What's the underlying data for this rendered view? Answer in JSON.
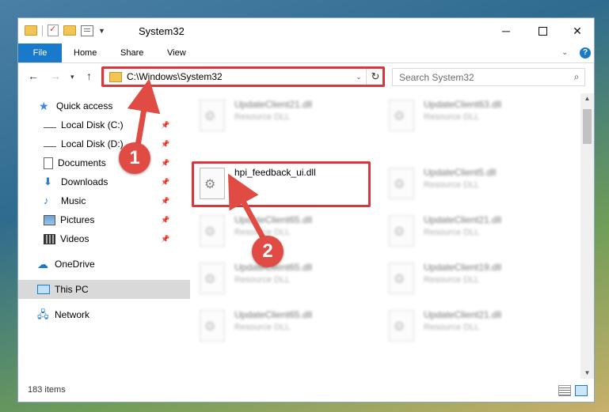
{
  "window": {
    "title": "System32"
  },
  "ribbon": {
    "tabs": [
      "File",
      "Home",
      "Share",
      "View"
    ],
    "help": "?"
  },
  "address": {
    "path": "C:\\Windows\\System32",
    "search_placeholder": "Search System32"
  },
  "sidebar": {
    "quick_access": "Quick access",
    "items": [
      {
        "label": "Local Disk (C:)",
        "icon": "drive-icon"
      },
      {
        "label": "Local Disk (D:)",
        "icon": "drive-icon"
      },
      {
        "label": "Documents",
        "icon": "documents-icon"
      },
      {
        "label": "Downloads",
        "icon": "downloads-icon"
      },
      {
        "label": "Music",
        "icon": "music-icon"
      },
      {
        "label": "Pictures",
        "icon": "pictures-icon"
      },
      {
        "label": "Videos",
        "icon": "videos-icon"
      }
    ],
    "onedrive": "OneDrive",
    "this_pc": "This PC",
    "network": "Network"
  },
  "files": {
    "left": [
      {
        "name": "UpdateClient21.dll",
        "type": "Resource DLL"
      },
      {
        "name": "hpi_feedback_ui.dll",
        "type": ""
      },
      {
        "name": "UpdateClient65.dll",
        "type": "Resource DLL"
      },
      {
        "name": "UpdateClient65.dll",
        "type": "Resource DLL"
      },
      {
        "name": "UpdateClient65.dll",
        "type": "Resource DLL"
      }
    ],
    "right": [
      {
        "name": "UpdateClient63.dll",
        "type": "Resource DLL"
      },
      {
        "name": "UpdateClient5.dll",
        "type": "Resource DLL"
      },
      {
        "name": "UpdateClient21.dll",
        "type": "Resource DLL"
      },
      {
        "name": "UpdateClient19.dll",
        "type": "Resource DLL"
      },
      {
        "name": "UpdateClient21.dll",
        "type": "Resource DLL"
      }
    ]
  },
  "status": {
    "item_count": "183 items"
  },
  "annotations": {
    "step1": "1",
    "step2": "2",
    "color": "#e04c44"
  }
}
